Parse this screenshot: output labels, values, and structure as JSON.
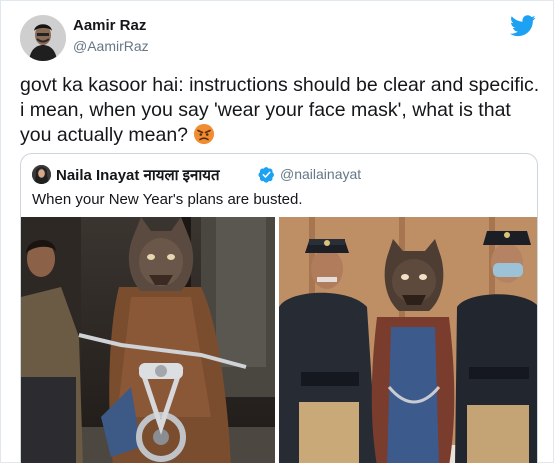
{
  "tweet": {
    "author_name": "Aamir Raz",
    "author_handle": "@AamirRaz",
    "text": "govt ka kasoor hai: instructions should be clear and specific. i mean, when you say 'wear your face mask', what is that you actually mean?",
    "emoji": "angry-face-emoji",
    "brand_icon": "twitter-bird-icon",
    "brand_color": "#1da1f2"
  },
  "quoted_tweet": {
    "author_name": "Naila Inayat नायला इनायत",
    "author_handle": "@nailainayat",
    "verified": true,
    "text": "When your New Year's plans are busted.",
    "images": [
      "man-in-wolf-mask-on-motorcycle-photo",
      "wolf-mask-man-held-by-police-photo"
    ]
  }
}
